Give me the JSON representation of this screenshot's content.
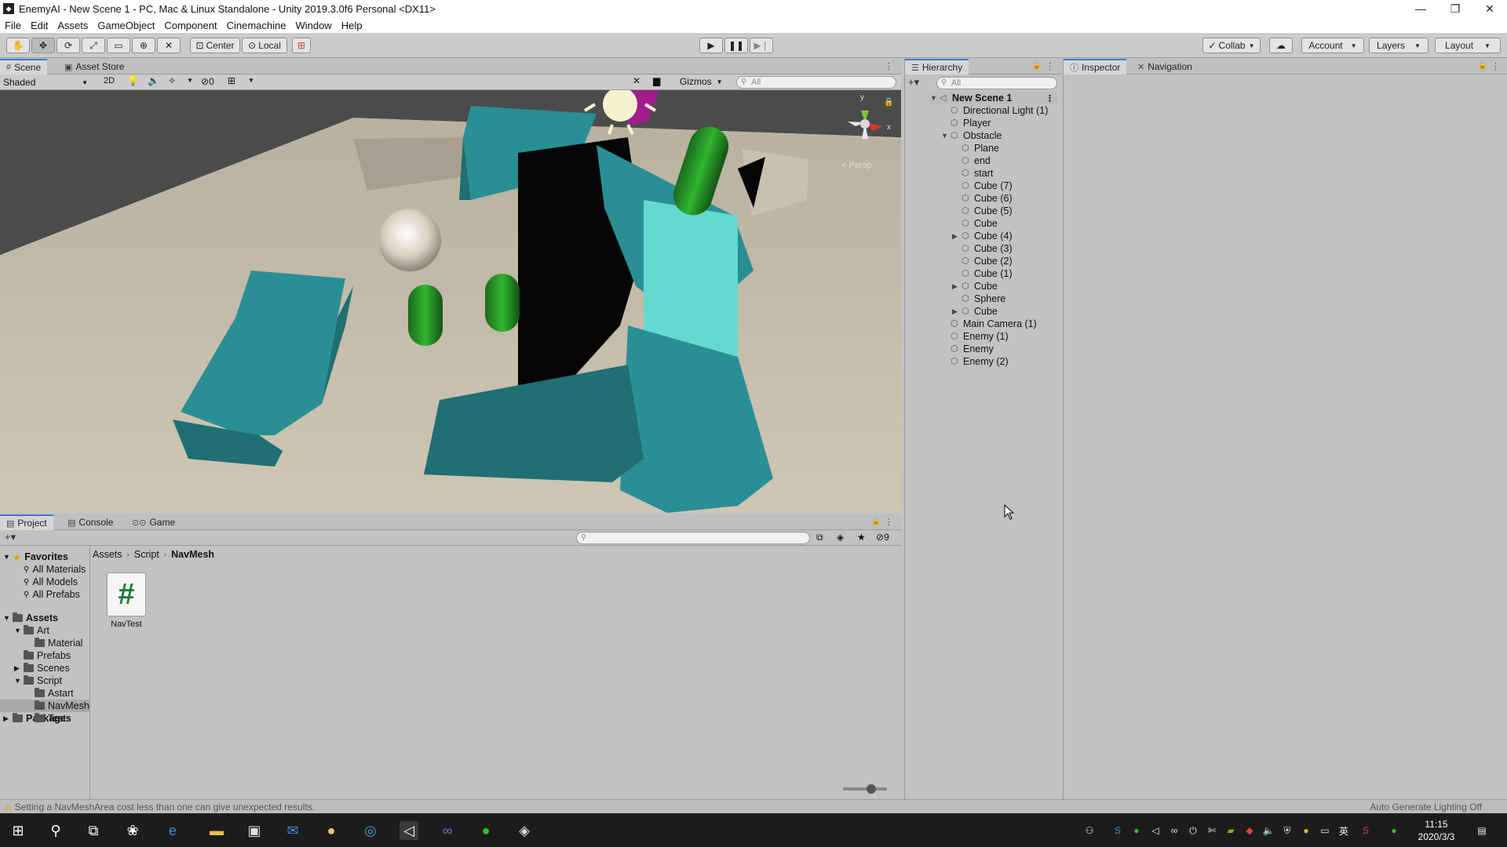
{
  "window": {
    "title": "EnemyAI - New Scene 1 - PC, Mac & Linux Standalone - Unity 2019.3.0f6 Personal <DX11>",
    "minimize": "—",
    "maximize": "❐",
    "close": "✕"
  },
  "menu": [
    "File",
    "Edit",
    "Assets",
    "GameObject",
    "Component",
    "Cinemachine",
    "Window",
    "Help"
  ],
  "toolbar": {
    "pivot_label": "Center",
    "space_label": "Local",
    "collab_label": "Collab",
    "account_label": "Account",
    "layers_label": "Layers",
    "layout_label": "Layout"
  },
  "scene_panel": {
    "tabs": [
      "Scene",
      "Asset Store"
    ],
    "shading_mode": "Shaded",
    "mode_2d": "2D",
    "hidden_count": "0",
    "gizmos_label": "Gizmos",
    "search_placeholder": "All",
    "persp_label": "< Persp",
    "axis_y": "y",
    "axis_x": "x"
  },
  "hierarchy": {
    "tab": "Hierarchy",
    "search_placeholder": "All",
    "scene": "New Scene 1",
    "items": [
      {
        "label": "Directional Light (1)",
        "depth": 1,
        "arrow": ""
      },
      {
        "label": "Player",
        "depth": 1,
        "arrow": ""
      },
      {
        "label": "Obstacle",
        "depth": 1,
        "arrow": "▼"
      },
      {
        "label": "Plane",
        "depth": 2,
        "arrow": ""
      },
      {
        "label": "end",
        "depth": 2,
        "arrow": ""
      },
      {
        "label": "start",
        "depth": 2,
        "arrow": ""
      },
      {
        "label": "Cube (7)",
        "depth": 2,
        "arrow": ""
      },
      {
        "label": "Cube (6)",
        "depth": 2,
        "arrow": ""
      },
      {
        "label": "Cube (5)",
        "depth": 2,
        "arrow": ""
      },
      {
        "label": "Cube",
        "depth": 2,
        "arrow": ""
      },
      {
        "label": "Cube (4)",
        "depth": 2,
        "arrow": "▶"
      },
      {
        "label": "Cube (3)",
        "depth": 2,
        "arrow": ""
      },
      {
        "label": "Cube (2)",
        "depth": 2,
        "arrow": ""
      },
      {
        "label": "Cube (1)",
        "depth": 2,
        "arrow": ""
      },
      {
        "label": "Cube",
        "depth": 2,
        "arrow": "▶"
      },
      {
        "label": "Sphere",
        "depth": 2,
        "arrow": ""
      },
      {
        "label": "Cube",
        "depth": 2,
        "arrow": "▶"
      },
      {
        "label": "Main Camera (1)",
        "depth": 1,
        "arrow": ""
      },
      {
        "label": "Enemy (1)",
        "depth": 1,
        "arrow": ""
      },
      {
        "label": "Enemy",
        "depth": 1,
        "arrow": ""
      },
      {
        "label": "Enemy (2)",
        "depth": 1,
        "arrow": ""
      }
    ]
  },
  "inspector": {
    "tabs": [
      "Inspector",
      "Navigation"
    ]
  },
  "project": {
    "tabs": [
      "Project",
      "Console",
      "Game"
    ],
    "hidden_count": "9",
    "breadcrumb": [
      "Assets",
      "Script",
      "NavMesh"
    ],
    "favorites_label": "Favorites",
    "favorites": [
      "All Materials",
      "All Models",
      "All Prefabs"
    ],
    "assets_label": "Assets",
    "tree": [
      {
        "label": "Art",
        "depth": 1,
        "arrow": "▼"
      },
      {
        "label": "Material",
        "depth": 2,
        "arrow": ""
      },
      {
        "label": "Prefabs",
        "depth": 1,
        "arrow": ""
      },
      {
        "label": "Scenes",
        "depth": 1,
        "arrow": "▶"
      },
      {
        "label": "Script",
        "depth": 1,
        "arrow": "▼"
      },
      {
        "label": "Astart",
        "depth": 2,
        "arrow": ""
      },
      {
        "label": "NavMesh",
        "depth": 2,
        "arrow": ""
      },
      {
        "label": "Test",
        "depth": 2,
        "arrow": ""
      }
    ],
    "packages_label": "Packages",
    "asset": {
      "name": "NavTest",
      "glyph": "#"
    }
  },
  "status": {
    "message": "Setting a NavMeshArea cost less than one can give unexpected results.",
    "lighting": "Auto Generate Lighting Off"
  },
  "taskbar": {
    "time": "11:15",
    "date": "2020/3/3",
    "ime": "英"
  },
  "colors": {
    "teal": "#2a8f95",
    "teal_dark": "#1f6f74",
    "light_cyan": "#63d9d0",
    "floor": "#c0b8a6",
    "green": "#2aa12a",
    "accent_blue": "#3c78d8"
  }
}
